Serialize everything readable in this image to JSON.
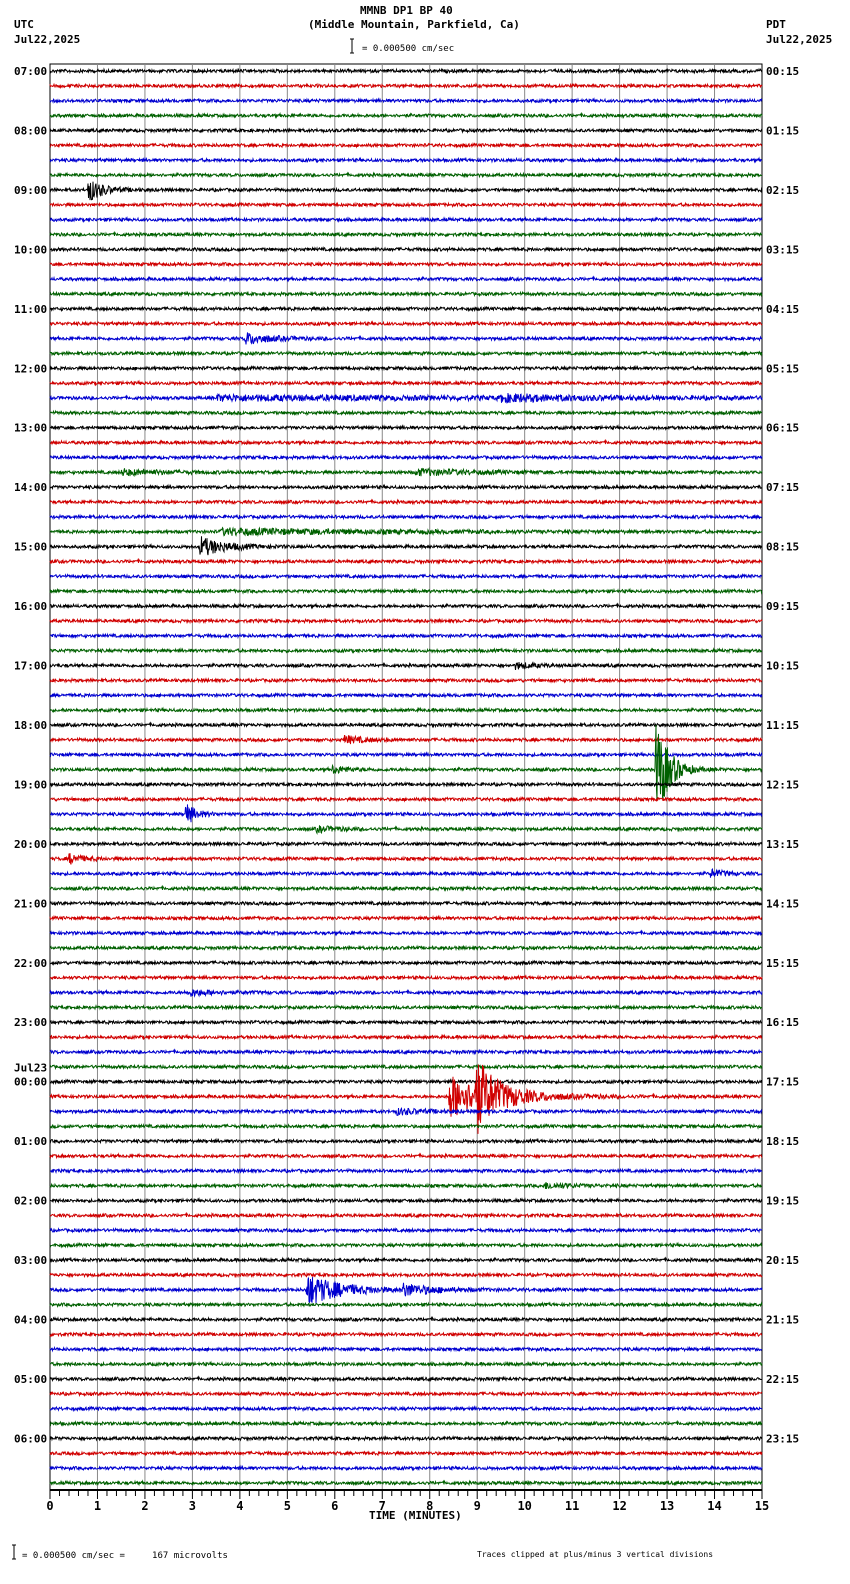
{
  "header": {
    "title": "MMNB DP1 BP 40",
    "subtitle": "(Middle Mountain, Parkfield, Ca)",
    "left_tz": "UTC",
    "left_date": "Jul22,2025",
    "right_tz": "PDT",
    "right_date": "Jul22,2025",
    "scale": "= 0.000500 cm/sec"
  },
  "footer": {
    "scale": "= 0.000500 cm/sec =     167 microvolts",
    "clip_note": "Traces clipped at plus/minus 3 vertical divisions"
  },
  "chart_data": {
    "type": "line",
    "subtype": "helicorder",
    "xlabel": "TIME (MINUTES)",
    "xlim": [
      0,
      15
    ],
    "x_ticks": [
      "0",
      "1",
      "2",
      "3",
      "4",
      "5",
      "6",
      "7",
      "8",
      "9",
      "10",
      "11",
      "12",
      "13",
      "14",
      "15"
    ],
    "grid": true,
    "trace_colors": [
      "#000000",
      "#d00000",
      "#0000d0",
      "#006000"
    ],
    "traces_per_hour": 4,
    "left_labels": [
      "07:00",
      "08:00",
      "09:00",
      "10:00",
      "11:00",
      "12:00",
      "13:00",
      "14:00",
      "15:00",
      "16:00",
      "17:00",
      "18:00",
      "19:00",
      "20:00",
      "21:00",
      "22:00",
      "23:00",
      "00:00",
      "01:00",
      "02:00",
      "03:00",
      "04:00",
      "05:00",
      "06:00"
    ],
    "date_change_label": "Jul23",
    "right_labels": [
      "00:15",
      "01:15",
      "02:15",
      "03:15",
      "04:15",
      "05:15",
      "06:15",
      "07:15",
      "08:15",
      "09:15",
      "10:15",
      "11:15",
      "12:15",
      "13:15",
      "14:15",
      "15:15",
      "16:15",
      "17:15",
      "18:15",
      "19:15",
      "20:15",
      "21:15",
      "22:15",
      "23:15"
    ],
    "events": [
      {
        "trace": 8,
        "minute": 0.8,
        "amplitude": 12,
        "decay": 0.3
      },
      {
        "trace": 18,
        "minute": 4.1,
        "amplitude": 6,
        "decay": 0.5
      },
      {
        "trace": 22,
        "minute": 3.5,
        "amplitude": 2.5,
        "decay": 6
      },
      {
        "trace": 22,
        "minute": 9.5,
        "amplitude": 3,
        "decay": 1.5
      },
      {
        "trace": 27,
        "minute": 1.5,
        "amplitude": 3,
        "decay": 0.8
      },
      {
        "trace": 27,
        "minute": 7.7,
        "amplitude": 3,
        "decay": 1.2
      },
      {
        "trace": 31,
        "minute": 3.6,
        "amplitude": 3,
        "decay": 3
      },
      {
        "trace": 32,
        "minute": 3.15,
        "amplitude": 10,
        "decay": 0.5
      },
      {
        "trace": 40,
        "minute": 9.8,
        "amplitude": 3,
        "decay": 0.4
      },
      {
        "trace": 45,
        "minute": 6.2,
        "amplitude": 4,
        "decay": 0.4
      },
      {
        "trace": 47,
        "minute": 5.95,
        "amplitude": 4,
        "decay": 0.3
      },
      {
        "trace": 47,
        "minute": 12.75,
        "amplitude": 60,
        "decay": 0.25
      },
      {
        "trace": 50,
        "minute": 2.85,
        "amplitude": 12,
        "decay": 0.2
      },
      {
        "trace": 51,
        "minute": 5.6,
        "amplitude": 3,
        "decay": 0.4
      },
      {
        "trace": 53,
        "minute": 0.4,
        "amplitude": 5,
        "decay": 0.3
      },
      {
        "trace": 54,
        "minute": 13.9,
        "amplitude": 4,
        "decay": 0.3
      },
      {
        "trace": 62,
        "minute": 2.9,
        "amplitude": 3.5,
        "decay": 0.5
      },
      {
        "trace": 69,
        "minute": 8.4,
        "amplitude": 22,
        "decay": 0.9
      },
      {
        "trace": 69,
        "minute": 8.95,
        "amplitude": 30,
        "decay": 0.4
      },
      {
        "trace": 70,
        "minute": 7.3,
        "amplitude": 3,
        "decay": 0.6
      },
      {
        "trace": 75,
        "minute": 10.4,
        "amplitude": 3,
        "decay": 0.5
      },
      {
        "trace": 82,
        "minute": 5.4,
        "amplitude": 16,
        "decay": 0.7
      },
      {
        "trace": 82,
        "minute": 7.4,
        "amplitude": 6,
        "decay": 0.6
      }
    ]
  }
}
